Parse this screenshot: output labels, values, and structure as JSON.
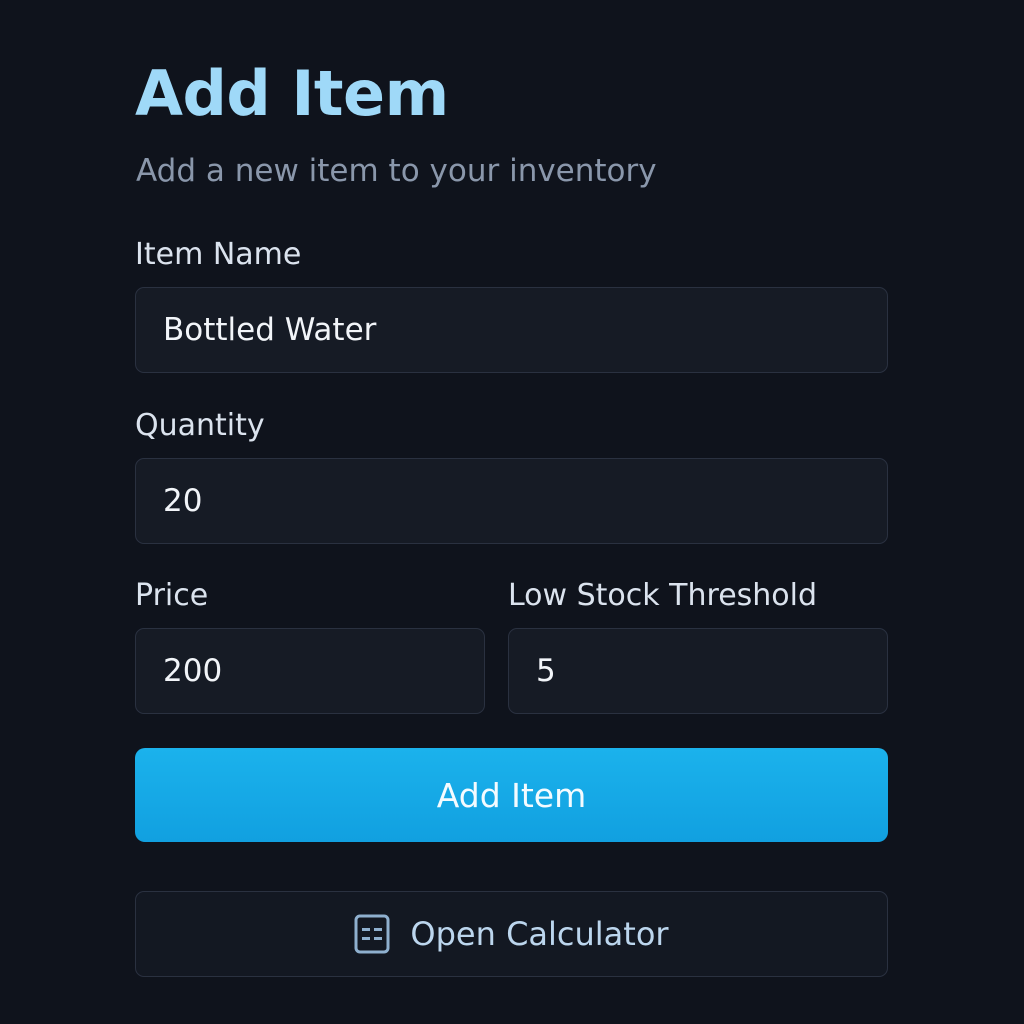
{
  "page": {
    "title": "Add Item",
    "subtitle": "Add a new item to your inventory"
  },
  "form": {
    "item_name": {
      "label": "Item Name",
      "value": "Bottled Water"
    },
    "quantity": {
      "label": "Quantity",
      "value": "20"
    },
    "price": {
      "label": "Price",
      "value": "200"
    },
    "low_stock_threshold": {
      "label": "Low Stock Threshold",
      "value": "5"
    }
  },
  "actions": {
    "add_item_label": "Add Item",
    "open_calculator_label": "Open Calculator",
    "open_calculator_icon": "calculator-icon"
  },
  "colors": {
    "background": "#0f131c",
    "title": "#9fd9f8",
    "accent": "#1bb2ec"
  }
}
